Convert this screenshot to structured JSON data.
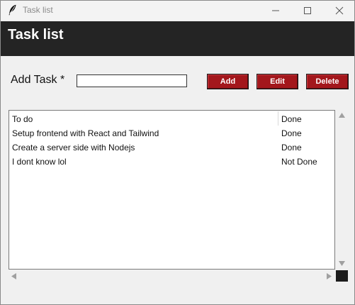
{
  "window": {
    "title": "Task list",
    "icon": "feather-icon",
    "controls": [
      "minimize-icon",
      "maximize-icon",
      "close-icon"
    ]
  },
  "header": {
    "title": "Task list",
    "background": "#242424"
  },
  "form": {
    "label": "Add Task *",
    "input_value": "",
    "buttons": {
      "add": "Add",
      "edit": "Edit",
      "delete": "Delete"
    },
    "button_color": "#a3171c"
  },
  "tasks": [
    {
      "task": "To do",
      "status": "Done"
    },
    {
      "task": "Setup frontend with React and Tailwind",
      "status": "Done"
    },
    {
      "task": "Create a server side with Nodejs",
      "status": "Done"
    },
    {
      "task": "I dont know lol",
      "status": "Not Done"
    }
  ],
  "scrollbars": {
    "vertical": true,
    "horizontal": true
  }
}
